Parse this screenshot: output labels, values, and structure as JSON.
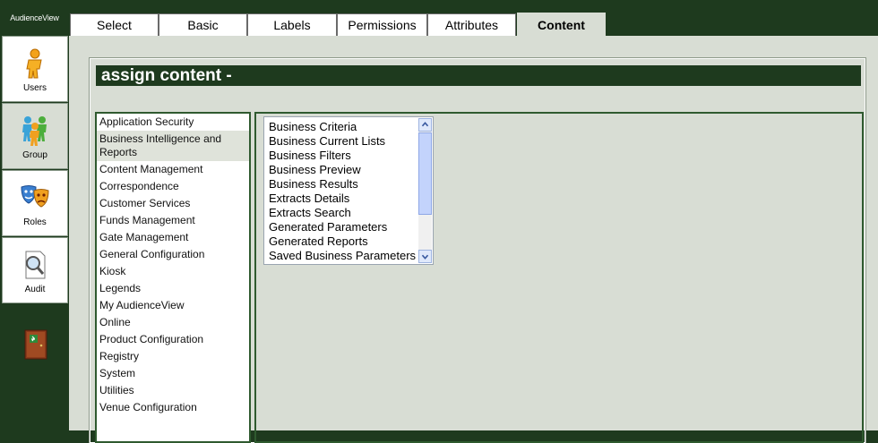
{
  "app": {
    "brand": "AudienceView"
  },
  "sidebar": {
    "items": [
      {
        "label": "Users",
        "icon": "user-icon"
      },
      {
        "label": "Group",
        "icon": "group-icon"
      },
      {
        "label": "Roles",
        "icon": "theater-masks-icon"
      },
      {
        "label": "Audit",
        "icon": "magnifier-document-icon"
      }
    ],
    "exit_icon": "exit-door-icon"
  },
  "tabs": [
    {
      "label": "Select"
    },
    {
      "label": "Basic"
    },
    {
      "label": "Labels"
    },
    {
      "label": "Permissions"
    },
    {
      "label": "Attributes"
    },
    {
      "label": "Content",
      "active": true
    }
  ],
  "section": {
    "title": "assign content -"
  },
  "categories": [
    "Application Security",
    "Business Intelligence and Reports",
    "Content Management",
    "Correspondence",
    "Customer Services",
    "Funds Management",
    "Gate Management",
    "General Configuration",
    "Kiosk",
    "Legends",
    "My AudienceView",
    "Online",
    "Product Configuration",
    "Registry",
    "System",
    "Utilities",
    "Venue Configuration"
  ],
  "selected_category": "Business Intelligence and Reports",
  "content_items": [
    "Business Criteria",
    "Business Current Lists",
    "Business Filters",
    "Business Preview",
    "Business Results",
    "Extracts Details",
    "Extracts Search",
    "Generated Parameters",
    "Generated Reports",
    "Saved Business Parameters"
  ],
  "colors": {
    "dark_green": "#1e3a1e",
    "panel_bg": "#d8ddd4",
    "border_green": "#2f5a2f"
  }
}
